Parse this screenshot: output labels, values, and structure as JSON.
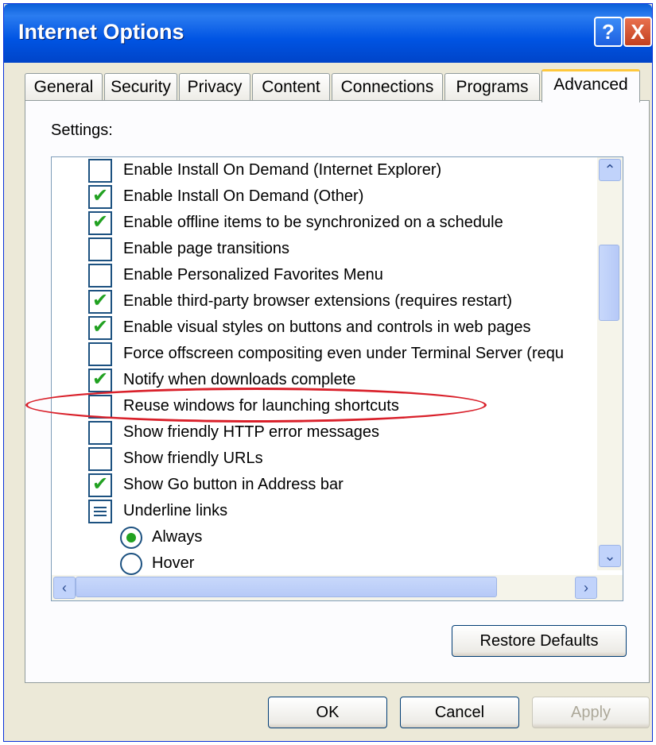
{
  "window": {
    "title": "Internet Options"
  },
  "titlebar_buttons": {
    "help": "?",
    "close": "X"
  },
  "tabs": [
    {
      "label": "General"
    },
    {
      "label": "Security"
    },
    {
      "label": "Privacy"
    },
    {
      "label": "Content"
    },
    {
      "label": "Connections"
    },
    {
      "label": "Programs"
    },
    {
      "label": "Advanced"
    }
  ],
  "active_tab": "Advanced",
  "settings_label": "Settings:",
  "settings": [
    {
      "label": "Enable Install On Demand (Internet Explorer)",
      "checked": false
    },
    {
      "label": "Enable Install On Demand (Other)",
      "checked": true
    },
    {
      "label": "Enable offline items to be synchronized on a schedule",
      "checked": true
    },
    {
      "label": "Enable page transitions",
      "checked": false
    },
    {
      "label": "Enable Personalized Favorites Menu",
      "checked": false
    },
    {
      "label": "Enable third-party browser extensions (requires restart)",
      "checked": true
    },
    {
      "label": "Enable visual styles on buttons and controls in web pages",
      "checked": true
    },
    {
      "label": "Force offscreen compositing even under Terminal Server (requ",
      "checked": false
    },
    {
      "label": "Notify when downloads complete",
      "checked": true
    },
    {
      "label": "Reuse windows for launching shortcuts",
      "checked": false
    },
    {
      "label": "Show friendly HTTP error messages",
      "checked": false
    },
    {
      "label": "Show friendly URLs",
      "checked": false
    },
    {
      "label": "Show Go button in Address bar",
      "checked": true
    }
  ],
  "underline_group": {
    "label": "Underline links",
    "options": [
      {
        "label": "Always",
        "selected": true
      },
      {
        "label": "Hover",
        "selected": false
      }
    ]
  },
  "buttons": {
    "restore_defaults": "Restore Defaults",
    "ok": "OK",
    "cancel": "Cancel",
    "apply": "Apply"
  },
  "scroll_glyphs": {
    "up": "⌃",
    "down": "⌄",
    "left": "‹",
    "right": "›"
  },
  "colors": {
    "titlebar": "#0054e3",
    "check": "#21a121",
    "highlight_ring": "#d9202a"
  }
}
